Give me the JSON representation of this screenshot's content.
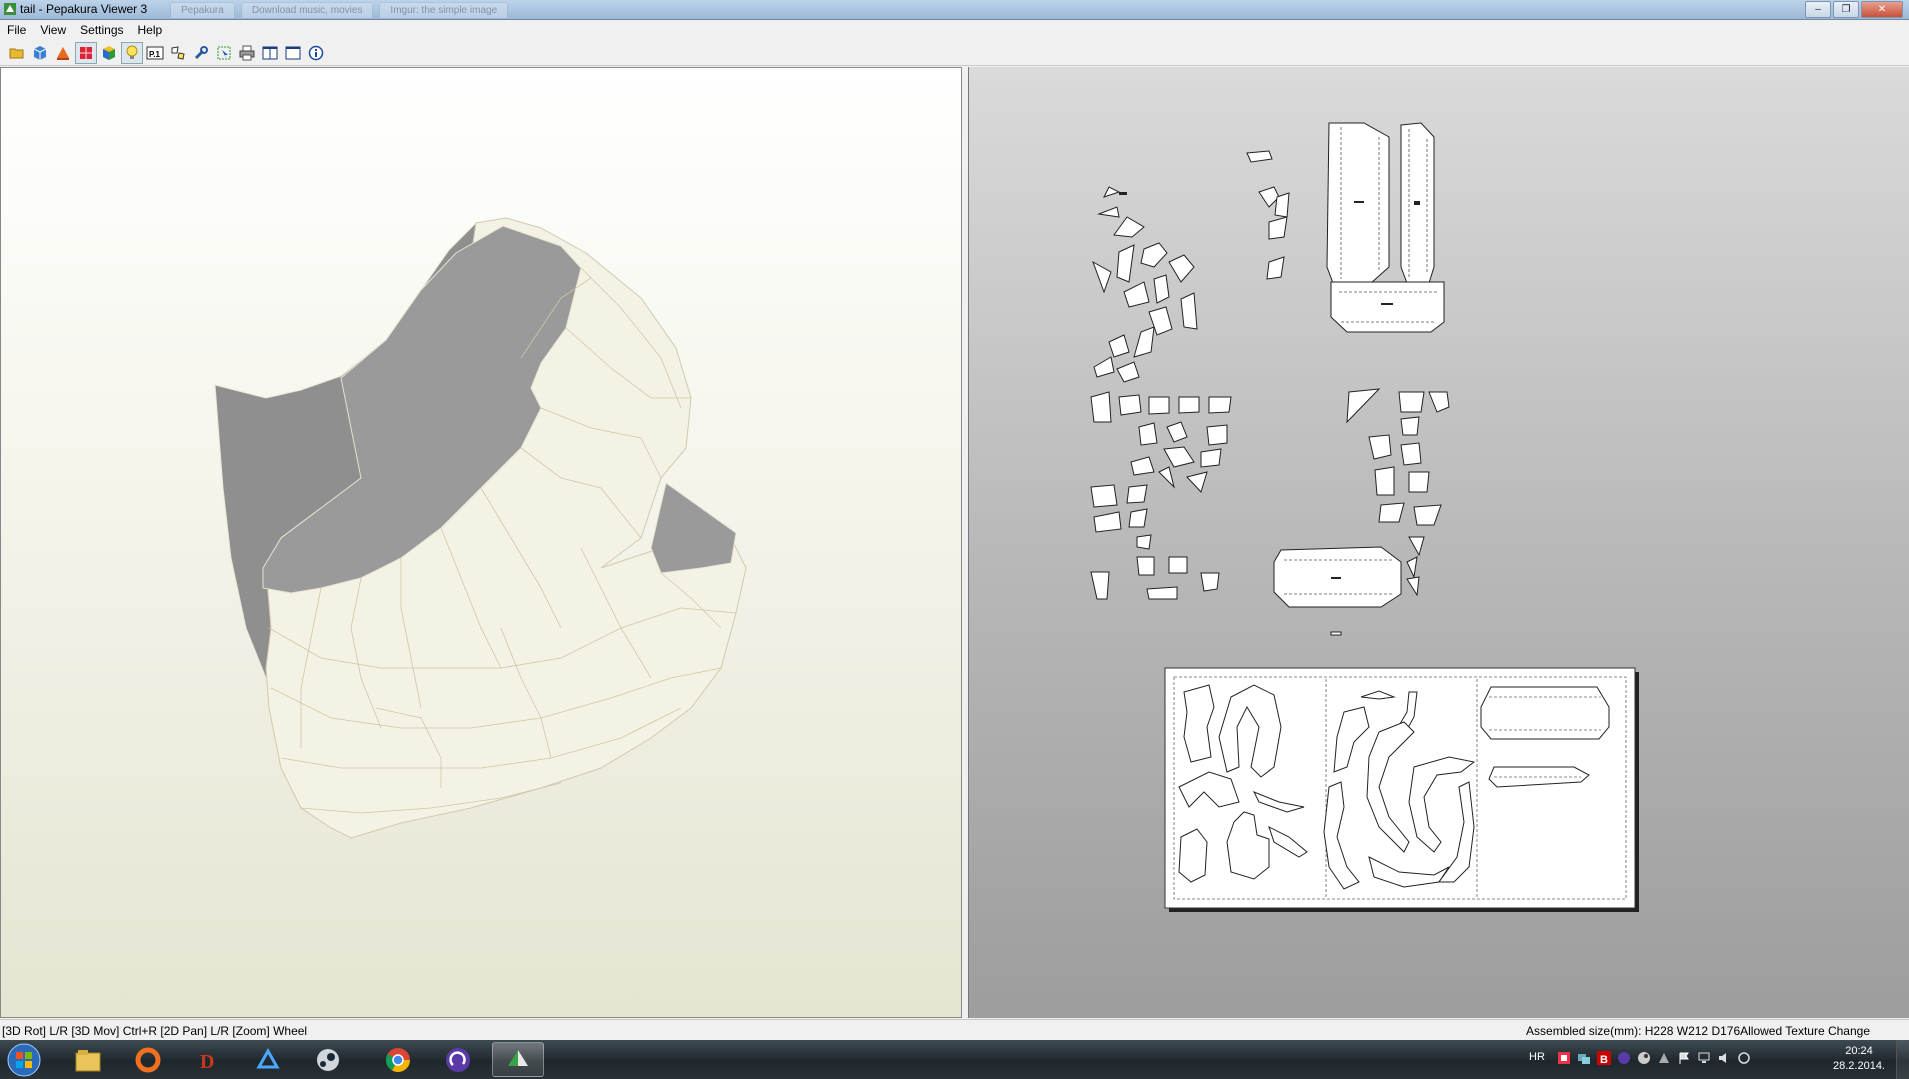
{
  "window": {
    "title": "tail - Pepakura Viewer 3",
    "background_tabs": [
      "Pepakura",
      "Download music, movies",
      "Imgur: the simple image"
    ],
    "controls": [
      "–",
      "❐",
      "✕"
    ]
  },
  "menu": [
    "File",
    "View",
    "Settings",
    "Help"
  ],
  "toolbar": {
    "buttons": [
      {
        "name": "open-file-button",
        "icon": "folder-icon"
      },
      {
        "name": "3d-view-button",
        "icon": "cube-icon"
      },
      {
        "name": "texture-button",
        "icon": "texture-icon"
      },
      {
        "name": "show-faces-button",
        "icon": "faces-icon",
        "pressed": true
      },
      {
        "name": "show-model-button",
        "icon": "cube-color-icon"
      },
      {
        "name": "light-button",
        "icon": "bulb-icon",
        "pressed": true
      },
      {
        "name": "page-number-button",
        "icon": "page-icon",
        "label": "P.1"
      },
      {
        "name": "layout-button",
        "icon": "pieces-icon"
      },
      {
        "name": "settings-button",
        "icon": "wrench-icon"
      },
      {
        "name": "select-button",
        "icon": "select-icon"
      },
      {
        "name": "print-button",
        "icon": "printer-icon"
      },
      {
        "name": "view-3d-only-button",
        "icon": "panel-left-icon"
      },
      {
        "name": "view-2d-only-button",
        "icon": "panel-right-icon"
      },
      {
        "name": "info-button",
        "icon": "info-icon"
      }
    ]
  },
  "status": {
    "left": "[3D Rot] L/R [3D Mov] Ctrl+R [2D Pan] L/R [Zoom] Wheel",
    "right": "Assembled size(mm): H228 W212 D176Allowed Texture Change"
  },
  "taskbar": {
    "apps": [
      "windows-explorer-icon",
      "origin-icon",
      "diablo-icon",
      "battlenet-icon",
      "steam-icon",
      "chrome-icon",
      "bittorrent-icon",
      "pepakura-icon"
    ],
    "active_app": "pepakura-icon",
    "language": "HR",
    "time": "20:24",
    "date": "28.2.2014."
  },
  "colors": {
    "model_fill": "#f5f3e6",
    "model_inside": "#9a9a9a",
    "view2d_bg": "#b5b5b5",
    "taskbar_bg": "#1e272c"
  }
}
